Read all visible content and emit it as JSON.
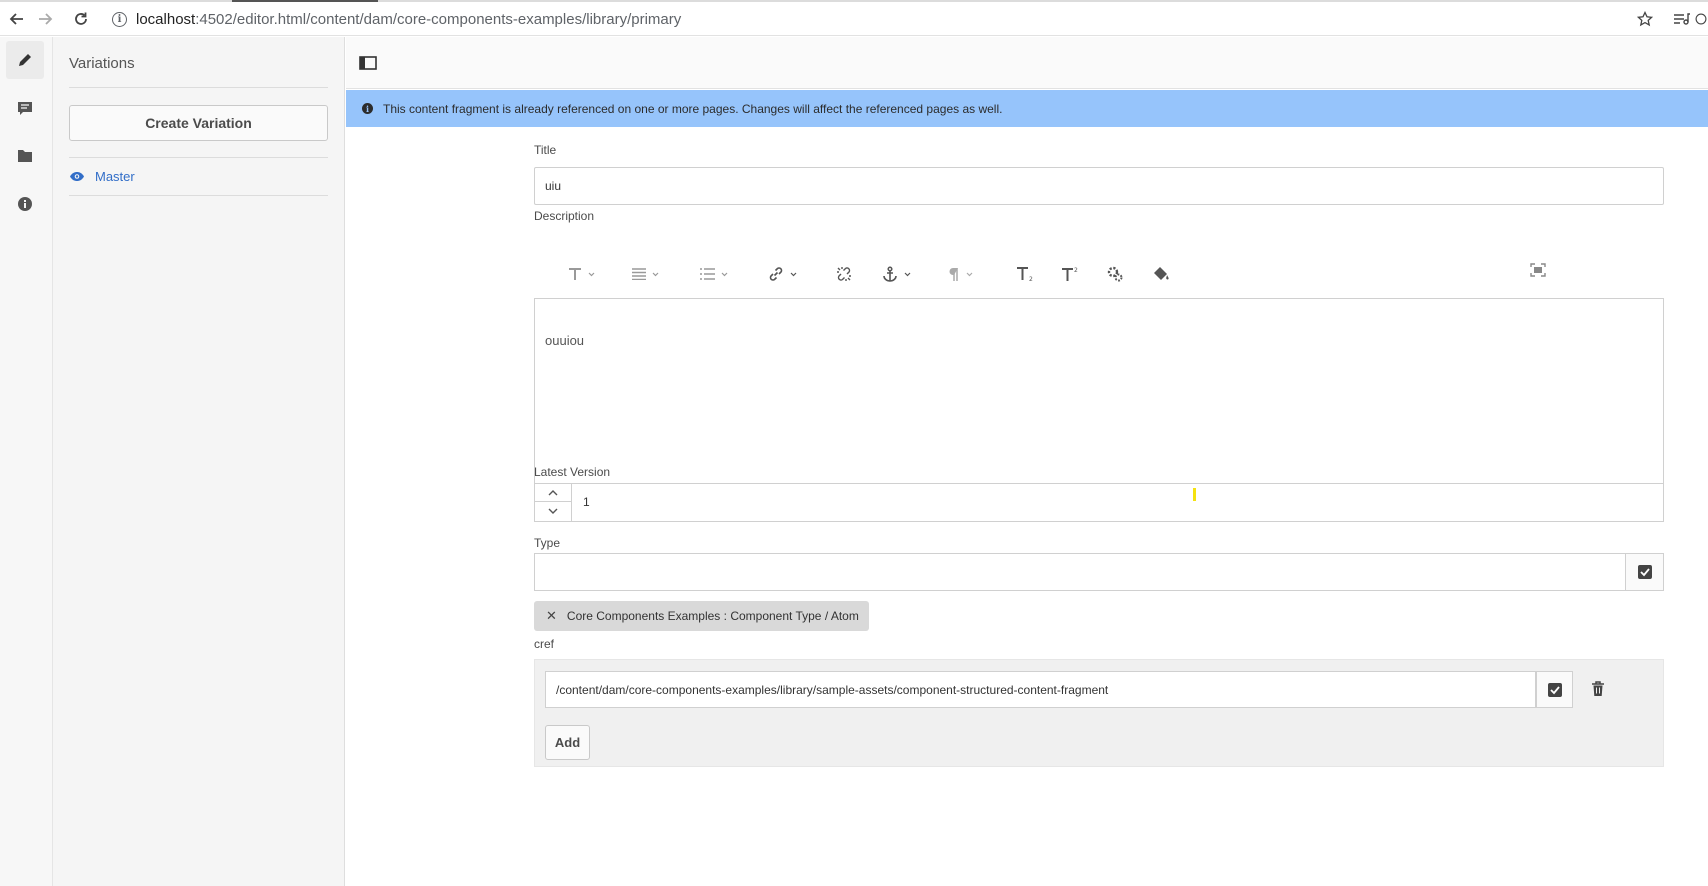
{
  "browser": {
    "url_host": "localhost",
    "url_path": ":4502/editor.html/content/dam/core-components-examples/library/primary"
  },
  "rail": {
    "items": [
      "edit-icon",
      "comment-icon",
      "folder-icon",
      "info-icon"
    ]
  },
  "side_panel": {
    "title": "Variations",
    "create_button": "Create Variation",
    "variations": [
      {
        "label": "Master",
        "icon": "eye-icon"
      }
    ]
  },
  "banner": {
    "text": "This content fragment is already referenced on one or more pages. Changes will affect the referenced pages as well."
  },
  "form": {
    "title_label": "Title",
    "title_value": "uiu",
    "description_label": "Description",
    "description_value": "ouuiou",
    "version_label": "Latest Version",
    "version_value": "1",
    "type_label": "Type",
    "type_value": "",
    "type_tag": "Core Components Examples : Component Type / Atom",
    "cref_label": "cref",
    "cref_value": "/content/dam/core-components-examples/library/sample-assets/component-structured-content-fragment",
    "add_button": "Add"
  },
  "rte_toolbar": [
    "text-format-icon",
    "align-icon",
    "list-icon",
    "link-icon",
    "unlink-icon",
    "anchor-icon",
    "paragraph-icon",
    "subscript-icon",
    "superscript-icon",
    "find-replace-icon",
    "paint-icon",
    "fullscreen-icon"
  ],
  "colors": {
    "banner": "#96c4fb",
    "link": "#326ec8",
    "rail": "#f7f7f7",
    "panel": "#f5f5f5"
  }
}
